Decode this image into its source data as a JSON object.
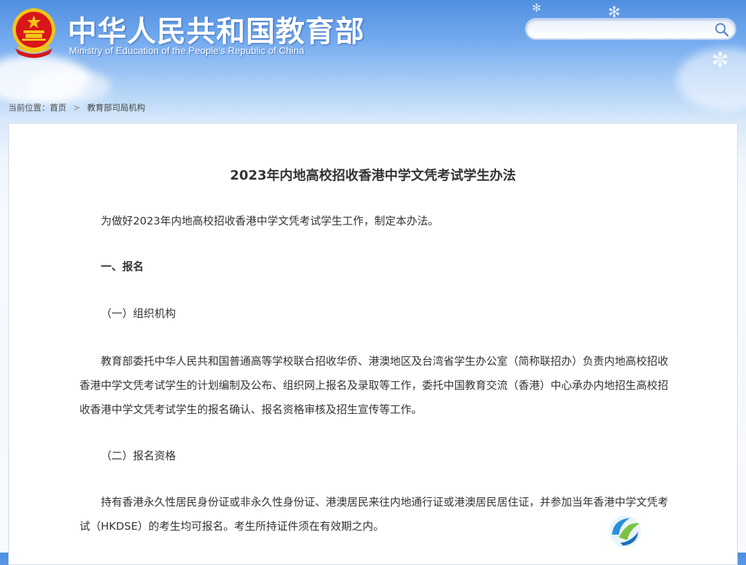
{
  "header": {
    "title": "中华人民共和国教育部",
    "subtitle": "Ministry of Education of the People's Republic of China",
    "emblem_icon": "national-emblem-icon"
  },
  "search": {
    "value": "",
    "placeholder": "",
    "icon": "search-icon"
  },
  "breadcrumb": {
    "label": "当前位置：",
    "items": [
      "首页",
      "教育部司局机构"
    ],
    "separator": ">"
  },
  "article": {
    "title": "2023年内地高校招收香港中学文凭考试学生办法",
    "paragraphs": [
      "为做好2023年内地高校招收香港中学文凭考试学生工作，制定本办法。",
      "一、报名",
      "（一）组织机构",
      "教育部委托中华人民共和国普通高等学校联合招收华侨、港澳地区及台湾省学生办公室（简称联招办）负责内地高校招收香港中学文凭考试学生的计划编制及公布、组织网上报名及录取等工作，委托中国教育交流（香港）中心承办内地招生高校招收香港中学文凭考试学生的报名确认、报名资格审核及招生宣传等工作。",
      "（二）报名资格",
      "持有香港永久性居民身份证或非永久性身份证、港澳居民来往内地通行证或港澳居民居住证，并参加当年香港中学文凭考试（HKDSE）的考生均可报名。考生所持证件须在有效期之内。"
    ]
  },
  "colors": {
    "banner_top": "#4f8fe0",
    "emblem_red": "#d8161b",
    "emblem_gold": "#f5c518",
    "text": "#333333"
  },
  "watermark_icon": "site-watermark-logo-icon"
}
